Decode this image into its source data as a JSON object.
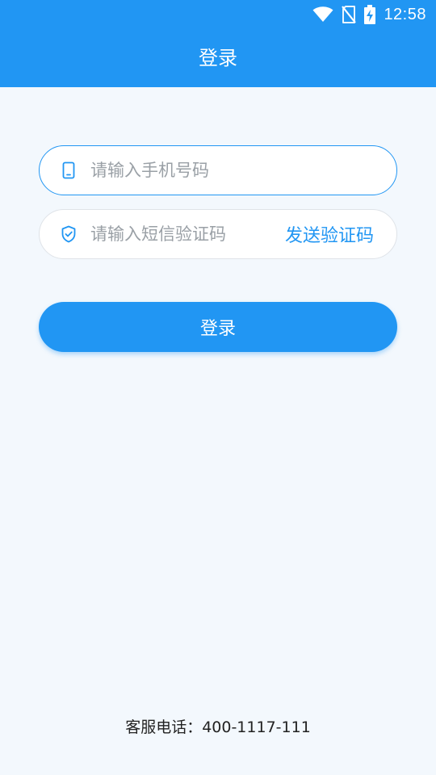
{
  "status_bar": {
    "time": "12:58",
    "icons": [
      "wifi-icon",
      "no-sim-icon",
      "battery-charging-icon"
    ]
  },
  "header": {
    "title": "登录"
  },
  "form": {
    "phone": {
      "icon": "phone-icon",
      "value": "",
      "placeholder": "请输入手机号码"
    },
    "sms_code": {
      "icon": "shield-icon",
      "value": "",
      "placeholder": "请输入短信验证码",
      "send_label": "发送验证码"
    },
    "login_label": "登录"
  },
  "footer": {
    "service_phone": "客服电话：400-1117-111"
  },
  "colors": {
    "primary": "#2196f3",
    "background": "#f3f8fd"
  }
}
